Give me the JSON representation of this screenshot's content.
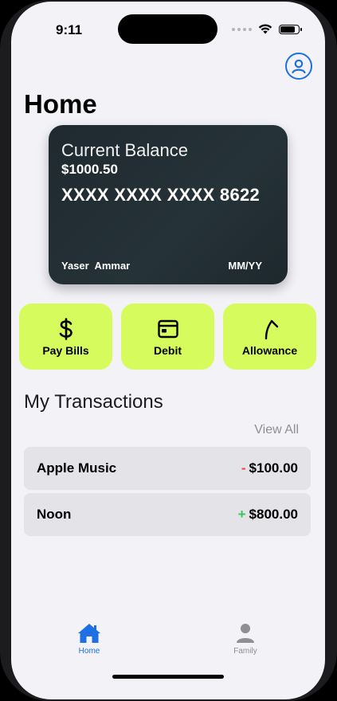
{
  "status_bar": {
    "time": "9:11"
  },
  "header": {
    "title": "Home"
  },
  "card": {
    "balance_label": "Current Balance",
    "balance_value": "$1000.50",
    "number": "XXXX XXXX XXXX 8622",
    "holder": "Yaser  Ammar",
    "expiry": "MM/YY"
  },
  "actions": [
    {
      "label": "Pay Bills",
      "icon": "dollar-icon"
    },
    {
      "label": "Debit",
      "icon": "card-icon"
    },
    {
      "label": "Allowance",
      "icon": "arrow-up-icon"
    }
  ],
  "transactions": {
    "title": "My Transactions",
    "view_all": "View All",
    "items": [
      {
        "name": "Apple Music",
        "sign": "-",
        "amount": "$100.00"
      },
      {
        "name": "Noon",
        "sign": "+",
        "amount": "$800.00"
      }
    ]
  },
  "tab_bar": {
    "tabs": [
      {
        "label": "Home",
        "icon": "house-icon",
        "active": true
      },
      {
        "label": "Family",
        "icon": "person-icon",
        "active": false
      }
    ]
  },
  "colors": {
    "accent": "#1e6fe3",
    "action_tile": "#d6fb5c",
    "negative": "#ff3b30",
    "positive": "#34c759",
    "card_bg": "#1f2a30"
  }
}
